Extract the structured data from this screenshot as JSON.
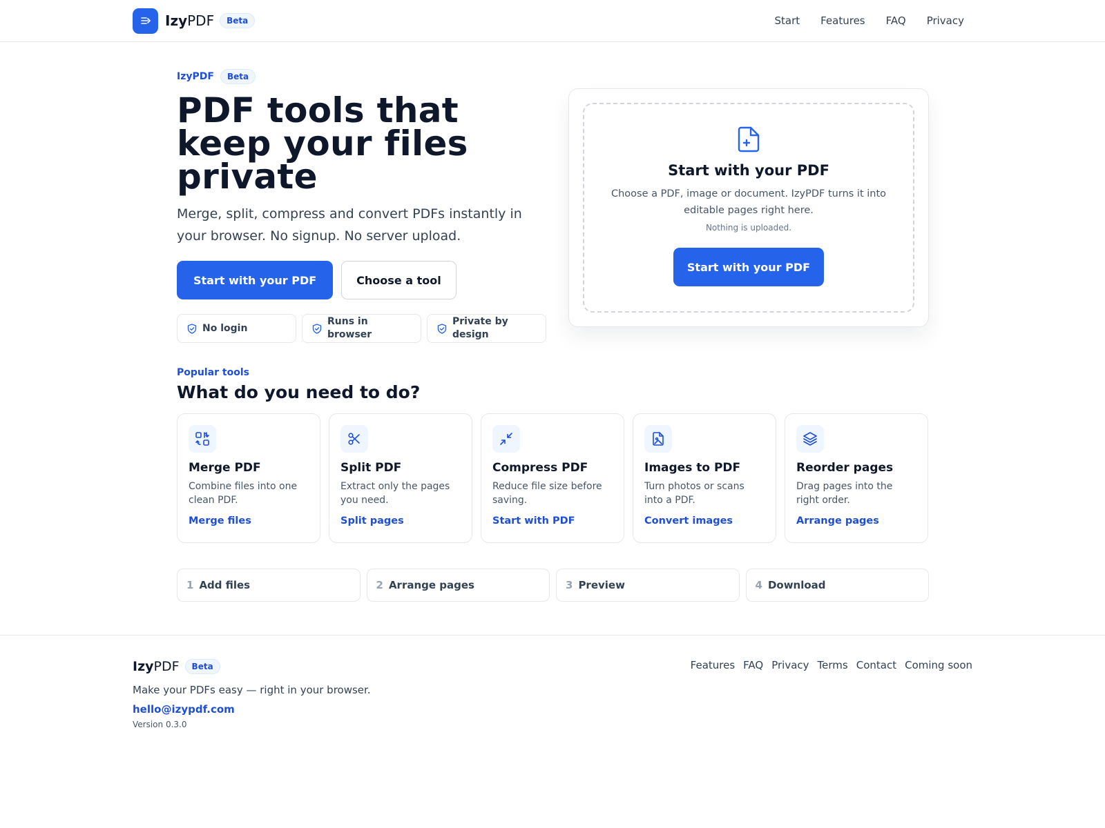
{
  "header": {
    "brand_bold": "Izy",
    "brand_rest": "PDF",
    "badge": "Beta",
    "nav": [
      "Start",
      "Features",
      "FAQ",
      "Privacy"
    ]
  },
  "hero": {
    "eyebrow": "IzyPDF",
    "badge": "Beta",
    "title": "PDF tools that keep your files private",
    "lead": "Merge, split, compress and convert PDFs instantly in your browser. No signup. No server upload.",
    "primary_cta": "Start with your PDF",
    "secondary_cta": "Choose a tool",
    "chips": [
      "No login",
      "Runs in browser",
      "Private by design"
    ]
  },
  "drop": {
    "title": "Start with your PDF",
    "description": "Choose a PDF, image or document. IzyPDF turns it into editable pages right here.",
    "note": "Nothing is uploaded.",
    "button": "Start with your PDF"
  },
  "tools": {
    "eyebrow": "Popular tools",
    "title": "What do you need to do?",
    "items": [
      {
        "name": "Merge PDF",
        "desc": "Combine files into one clean PDF.",
        "link": "Merge files",
        "icon": "merge-icon"
      },
      {
        "name": "Split PDF",
        "desc": "Extract only the pages you need.",
        "link": "Split pages",
        "icon": "scissors-icon"
      },
      {
        "name": "Compress PDF",
        "desc": "Reduce file size before saving.",
        "link": "Start with PDF",
        "icon": "compress-icon"
      },
      {
        "name": "Images to PDF",
        "desc": "Turn photos or scans into a PDF.",
        "link": "Convert images",
        "icon": "image-file-icon"
      },
      {
        "name": "Reorder pages",
        "desc": "Drag pages into the right order.",
        "link": "Arrange pages",
        "icon": "layers-icon"
      }
    ]
  },
  "steps": [
    {
      "num": "1",
      "label": "Add files"
    },
    {
      "num": "2",
      "label": "Arrange pages"
    },
    {
      "num": "3",
      "label": "Preview"
    },
    {
      "num": "4",
      "label": "Download"
    }
  ],
  "footer": {
    "brand_bold": "Izy",
    "brand_rest": "PDF",
    "badge": "Beta",
    "tagline": "Make your PDFs easy — right in your browser.",
    "email": "hello@izypdf.com",
    "version": "Version 0.3.0",
    "links": [
      "Features",
      "FAQ",
      "Privacy",
      "Terms",
      "Contact",
      "Coming soon"
    ]
  },
  "colors": {
    "accent": "#2563eb",
    "accent_text": "#1d4ed8",
    "badge_bg": "#eff6ff",
    "border": "#e5e7eb"
  }
}
